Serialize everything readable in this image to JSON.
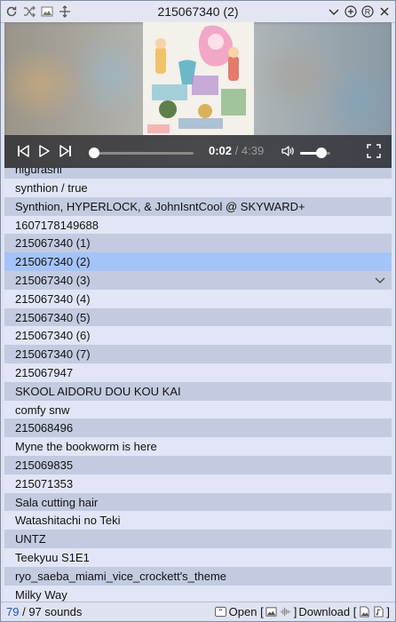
{
  "titlebar": {
    "title": "215067340 (2)",
    "left_icons": [
      "refresh-icon",
      "shuffle-icon",
      "image-icon",
      "move-icon"
    ],
    "right_icons": [
      "chevron-down-icon",
      "add-circle-icon",
      "registered-icon",
      "close-icon"
    ]
  },
  "player": {
    "current_time": "0:02",
    "separator": " / ",
    "duration": "4:39",
    "progress": 0.007,
    "volume": 0.7,
    "icons": [
      "skip-back-icon",
      "play-icon",
      "skip-forward-icon",
      "volume-icon",
      "fullscreen-icon"
    ]
  },
  "list": {
    "partial_top": "higurashi",
    "items": [
      "synthion / true",
      "Synthion, HYPERLOCK, & JohnIsntCool @ SKYWARD+",
      "1607178149688",
      "215067340 (1)",
      "215067340 (2)",
      "215067340 (3)",
      "215067340 (4)",
      "215067340 (5)",
      "215067340 (6)",
      "215067340 (7)",
      "215067947",
      "SKOOL AIDORU DOU KOU KAI",
      "comfy snw",
      "215068496",
      "Myne the bookworm is here",
      "215069835",
      "215071353",
      "Sala cutting hair",
      "Watashitachi no Teki",
      "UNTZ",
      "Teekyuu S1E1",
      "ryo_saeba_miami_vice_crockett's_theme",
      "Milky Way"
    ],
    "selected": "215067340 (2)"
  },
  "status": {
    "shown": "79",
    "sep": " / ",
    "total": "97",
    "unit": " sounds",
    "open_label": "Open [",
    "open_close": "]",
    "download_label": " Download [",
    "download_close": "]"
  },
  "colors": {
    "row_light": "#e1e5f5",
    "row_dark": "#c2cbe0",
    "row_selected": "#a4c3f8",
    "count_accent": "#2255cc"
  }
}
